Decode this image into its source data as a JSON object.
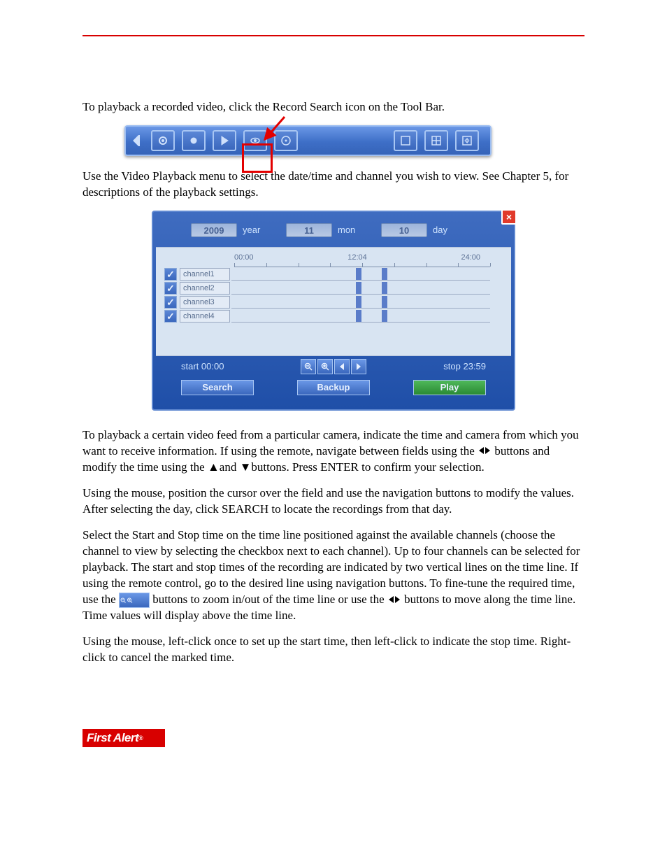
{
  "paragraphs": {
    "p1": "To playback a recorded video, click the Record Search icon on the Tool Bar.",
    "p2a": "Use the Video Playback menu to select the date/time and channel you wish to view. See Chapter 5, ",
    "p2b": " for descriptions of the playback settings.",
    "p3a": "To playback a certain video feed from a particular camera, indicate the time and camera from which you want to receive information. If using the remote, navigate between fields using the ",
    "p3b": " buttons and modify the time using the ▲and ▼buttons. Press ENTER to confirm your selection.",
    "p4": "Using the mouse, position the cursor over the field and use the navigation buttons to modify the values. After selecting the day, click SEARCH to locate the recordings from that day.",
    "p5a": "Select the Start and Stop time on the time line positioned against the available channels (choose the channel to view by selecting the checkbox next to each channel). Up to four channels can be selected for playback. The start and stop times of the recording are indicated by two vertical lines on the time line. If using the remote control, go to the desired line using navigation buttons. To fine-tune the required time, use the ",
    "p5b": " buttons to zoom in/out of the time line or use the ",
    "p5c": " buttons to move along the time line. Time values will display above the time line.",
    "p6": "Using the mouse, left-click once to set up the start time, then left-click to indicate the stop time. Right-click to cancel the marked time."
  },
  "toolbar": {
    "icons": [
      "left-arrow",
      "gear",
      "record",
      "play",
      "eye",
      "disc",
      "single-view",
      "quad-view",
      "sequence"
    ]
  },
  "playback_menu": {
    "close": "×",
    "date": {
      "year": "2009",
      "year_label": "year",
      "mon": "11",
      "mon_label": "mon",
      "day": "10",
      "day_label": "day"
    },
    "timeline": {
      "t0": "00:00",
      "tm": "12:04",
      "t1": "24:00"
    },
    "channels": [
      {
        "check": "✓",
        "name": "channel1"
      },
      {
        "check": "✓",
        "name": "channel2"
      },
      {
        "check": "✓",
        "name": "channel3"
      },
      {
        "check": "✓",
        "name": "channel4"
      }
    ],
    "start": "start 00:00",
    "stop": "stop 23:59",
    "search_btn": "Search",
    "backup_btn": "Backup",
    "play_btn": "Play"
  },
  "logo": {
    "text": "First Alert",
    "reg": "®"
  }
}
